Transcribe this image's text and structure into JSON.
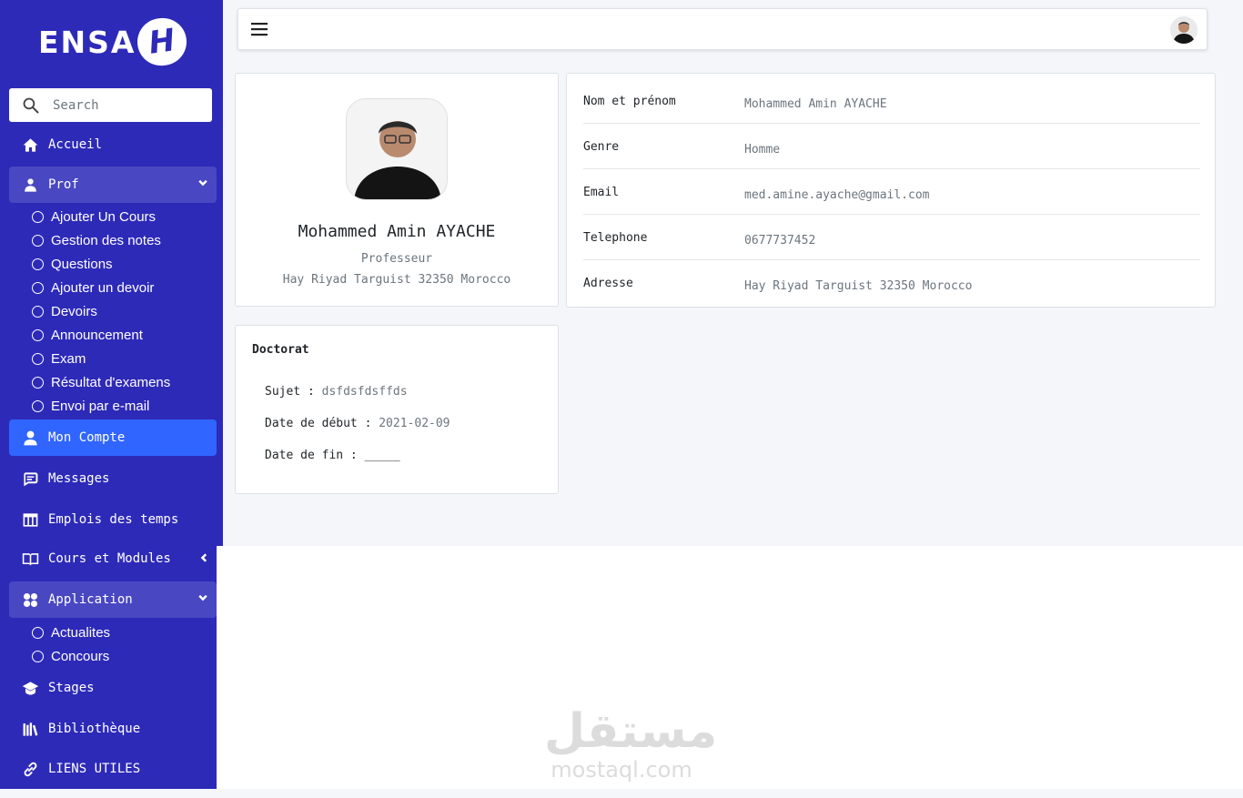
{
  "brand": {
    "logo_text": "ENSA",
    "logo_badge": "H"
  },
  "search": {
    "placeholder": "Search"
  },
  "sidebar": {
    "accueil": "Accueil",
    "prof": {
      "label": "Prof",
      "items": [
        "Ajouter Un Cours",
        "Gestion des notes",
        "Questions",
        "Ajouter un devoir",
        "Devoirs",
        "Announcement",
        "Exam",
        "Résultat d'examens",
        "Envoi par e-mail"
      ]
    },
    "mon_compte": "Mon Compte",
    "messages": "Messages",
    "emplois": "Emplois des temps",
    "cours_modules": "Cours et Modules",
    "application": {
      "label": "Application",
      "items": [
        "Actualites",
        "Concours"
      ]
    },
    "stages": "Stages",
    "bibliotheque": "Bibliothèque",
    "liens": "LIENS UTILES"
  },
  "profile": {
    "name": "Mohammed Amin AYACHE",
    "role": "Professeur",
    "address": "Hay Riyad Targuist 32350 Morocco"
  },
  "details": [
    {
      "label": "Nom et prénom",
      "value": "Mohammed Amin AYACHE"
    },
    {
      "label": "Genre",
      "value": "Homme"
    },
    {
      "label": "Email",
      "value": "med.amine.ayache@gmail.com"
    },
    {
      "label": "Telephone",
      "value": "0677737452"
    },
    {
      "label": "Adresse",
      "value": "Hay Riyad Targuist 32350 Morocco"
    }
  ],
  "doctorat": {
    "title": "Doctorat",
    "sujet_label": "Sujet : ",
    "sujet_value": "dsfdsfdsffds",
    "debut_label": "Date de début : ",
    "debut_value": "2021-02-09",
    "fin_label": "Date de fin : ",
    "fin_value": "_____"
  },
  "watermark": {
    "arabic": "مستقل",
    "latin": "mostaql.com"
  },
  "colors": {
    "sidebar": "#2e2ab8",
    "active": "#3065ff",
    "open": "#4a47c2",
    "background": "#f4f6f9"
  }
}
